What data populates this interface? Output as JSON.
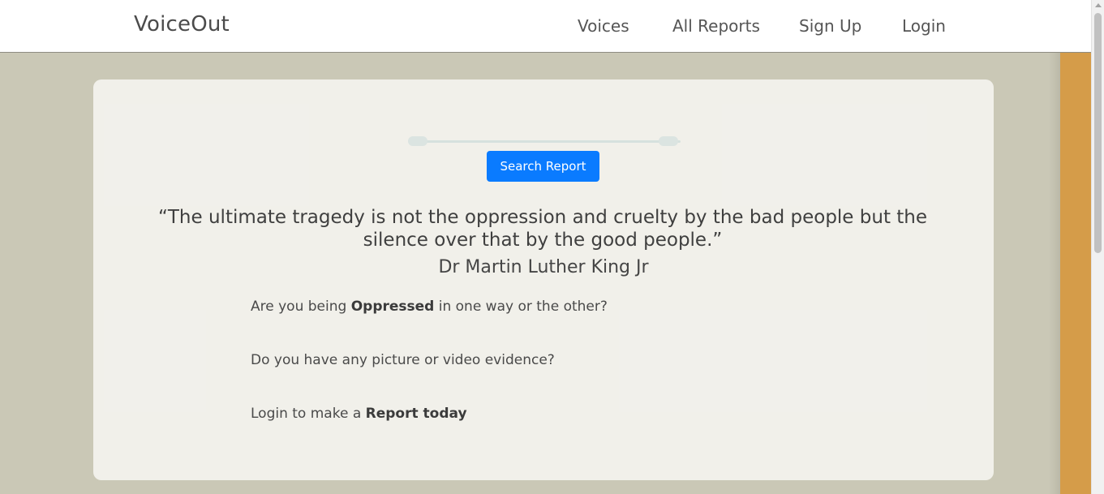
{
  "navbar": {
    "brand": "VoiceOut",
    "links": [
      "Voices",
      "All Reports",
      "Sign Up",
      "Login"
    ]
  },
  "hero": {
    "search_button": "Search Report",
    "quote": "“The ultimate tragedy is not the oppression and cruelty by the bad people but the silence over that by the good people.”",
    "author": "Dr Martin Luther King Jr",
    "line1": {
      "pre": "Are you being ",
      "bold": "Oppressed",
      "post": " in one way or the other?"
    },
    "line2": "Do you have any picture or video evidence?",
    "line3": {
      "pre": "Login to make a ",
      "bold": "Report today"
    }
  },
  "colors": {
    "navbar_bg": "#ffffff",
    "hero_bg": "#cac8b6",
    "card_bg": "#f4f3ef",
    "accent_strip": "#d59c49",
    "button": "#0a7bff"
  }
}
